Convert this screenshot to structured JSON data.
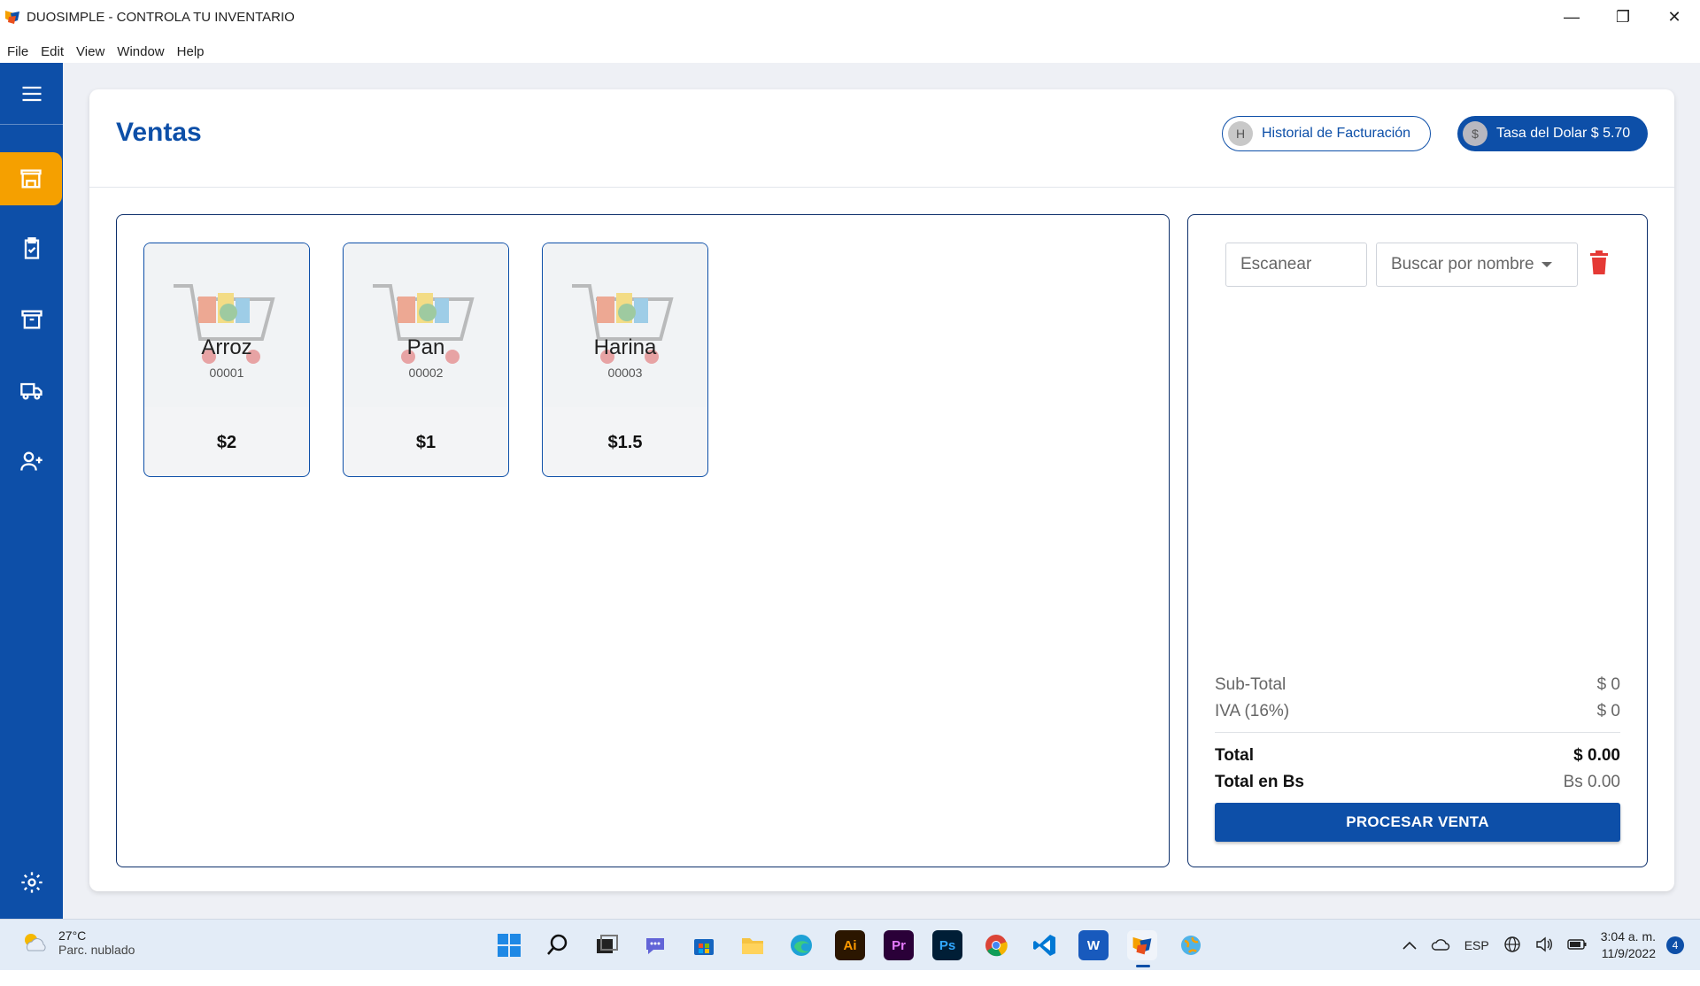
{
  "window": {
    "title": "DUOSIMPLE - CONTROLA TU INVENTARIO",
    "minimize": "—",
    "restore": "❐",
    "close": "✕"
  },
  "menu": [
    "File",
    "Edit",
    "View",
    "Window",
    "Help"
  ],
  "sidebar": {
    "items": [
      {
        "icon": "menu-icon"
      },
      {
        "icon": "store-icon",
        "active": true
      },
      {
        "icon": "clipboard-check-icon"
      },
      {
        "icon": "archive-icon"
      },
      {
        "icon": "truck-icon"
      },
      {
        "icon": "add-user-icon"
      },
      {
        "icon": "gear-icon"
      }
    ],
    "colors": {
      "bg": "#0d4fa8",
      "active": "#f5a000"
    }
  },
  "header": {
    "title": "Ventas",
    "history_badge": "H",
    "history_label": "Historial de Facturación",
    "rate_badge": "$",
    "rate_label": "Tasa del Dolar $ 5.70"
  },
  "products": [
    {
      "name": "Arroz",
      "code": "00001",
      "price": "$2"
    },
    {
      "name": "Pan",
      "code": "00002",
      "price": "$1"
    },
    {
      "name": "Harina",
      "code": "00003",
      "price": "$1.5"
    }
  ],
  "cart": {
    "scan_placeholder": "Escanear",
    "search_placeholder": "Buscar por nombre",
    "subtotal_label": "Sub-Total",
    "subtotal_value": "$ 0",
    "iva_label": "IVA (16%)",
    "iva_value": "$ 0",
    "total_label": "Total",
    "total_value": "$ 0.00",
    "total_bs_label": "Total en Bs",
    "total_bs_value": "Bs 0.00",
    "process_label": "PROCESAR VENTA"
  },
  "taskbar": {
    "temp": "27°C",
    "condition": "Parc. nublado",
    "apps": [
      {
        "label": "",
        "icon": "windows-start-icon"
      },
      {
        "label": "",
        "icon": "search-icon"
      },
      {
        "label": "",
        "icon": "task-view-icon"
      },
      {
        "label": "",
        "icon": "chat-icon"
      },
      {
        "label": "",
        "icon": "store-app-icon"
      },
      {
        "label": "",
        "icon": "file-explorer-icon"
      },
      {
        "label": "",
        "icon": "edge-icon"
      },
      {
        "label": "Ai",
        "icon": "illustrator-icon"
      },
      {
        "label": "Pr",
        "icon": "premiere-icon"
      },
      {
        "label": "Ps",
        "icon": "photoshop-icon"
      },
      {
        "label": "",
        "icon": "chrome-icon"
      },
      {
        "label": "",
        "icon": "vscode-icon"
      },
      {
        "label": "W",
        "icon": "word-icon"
      },
      {
        "label": "",
        "icon": "duosimple-icon",
        "active": true
      },
      {
        "label": "",
        "icon": "globe-app-icon"
      }
    ],
    "lang": "ESP",
    "time": "3:04 a. m.",
    "date": "11/9/2022",
    "notifications": "4"
  }
}
